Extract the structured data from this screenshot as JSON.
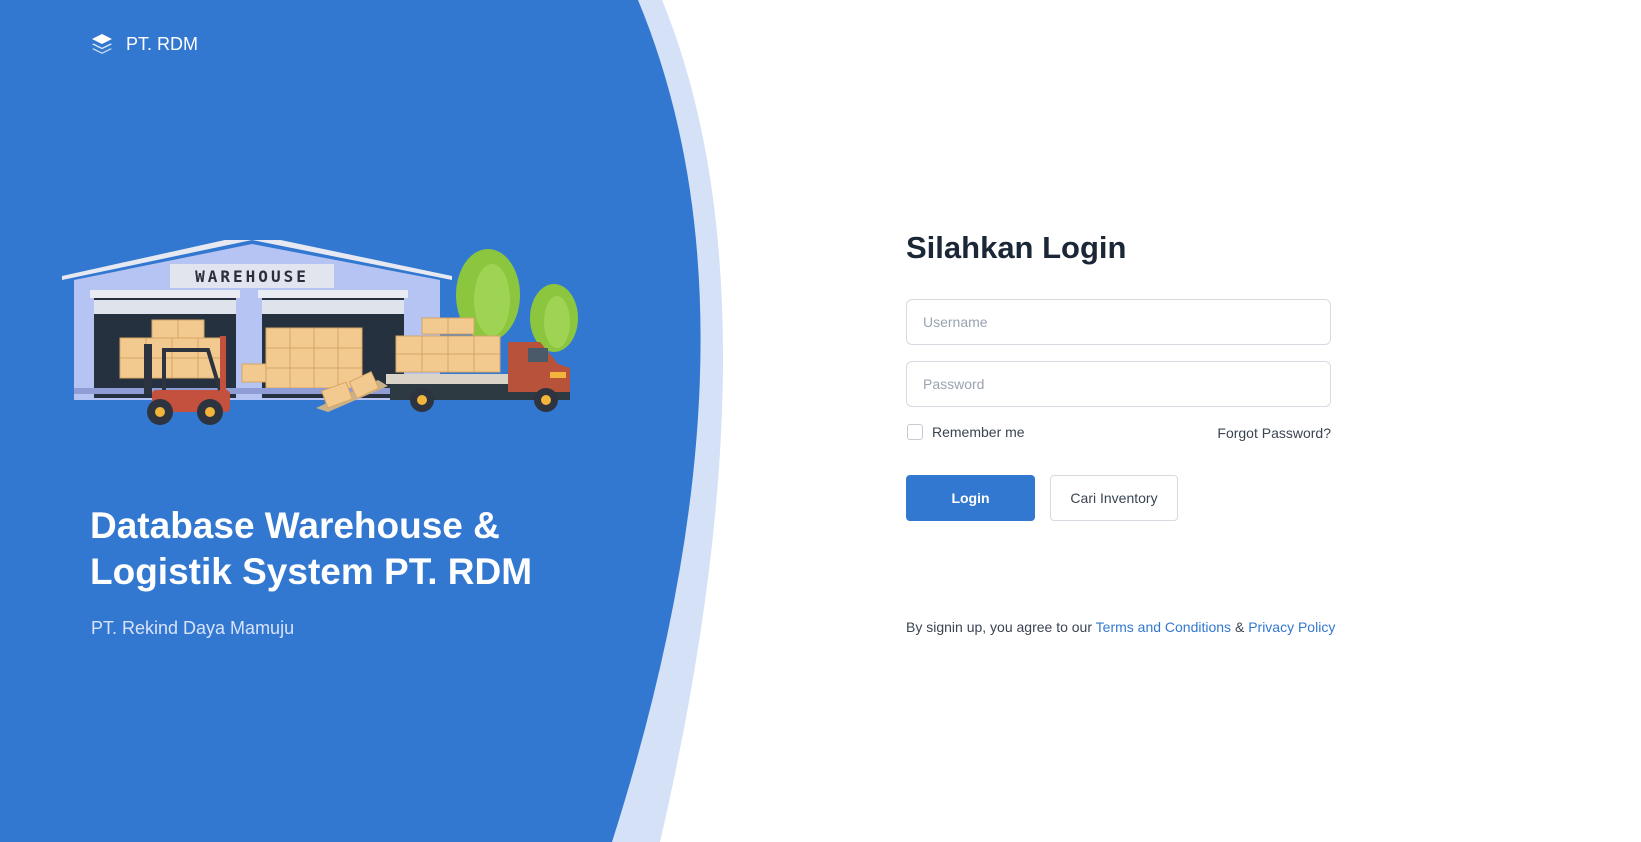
{
  "brand": {
    "name": "PT. RDM",
    "icon": "layers-icon"
  },
  "illustration": {
    "sign_text": "WAREHOUSE"
  },
  "hero": {
    "title_line1": "Database Warehouse &",
    "title_line2": "Logistik System PT. RDM",
    "subtitle": "PT. Rekind Daya Mamuju"
  },
  "login": {
    "title": "Silahkan Login",
    "username": {
      "placeholder": "Username",
      "value": ""
    },
    "password": {
      "placeholder": "Password",
      "value": ""
    },
    "remember_label": "Remember me",
    "remember_checked": false,
    "forgot_label": "Forgot Password?",
    "login_button": "Login",
    "inventory_button": "Cari Inventory"
  },
  "terms": {
    "prefix": "By signin up, you agree to our ",
    "terms_link": "Terms and Conditions",
    "separator": " & ",
    "privacy_link": "Privacy Policy"
  },
  "colors": {
    "primary": "#3378d0",
    "accent_light": "#d4e1f6",
    "text_dark": "#1b2636"
  }
}
